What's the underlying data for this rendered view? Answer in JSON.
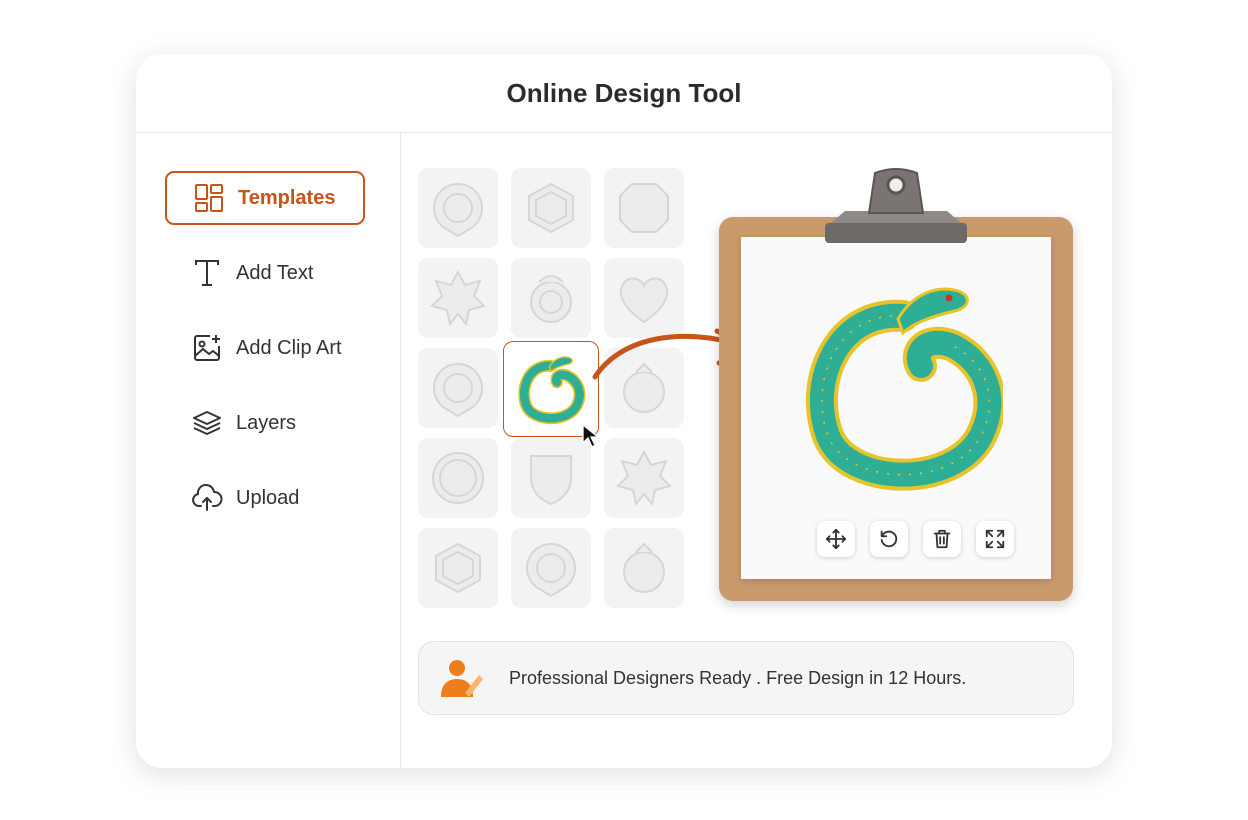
{
  "header": {
    "title": "Online Design Tool"
  },
  "sidebar": {
    "items": [
      {
        "label": "Templates",
        "icon": "grid-icon",
        "active": true
      },
      {
        "label": "Add Text",
        "icon": "text-icon"
      },
      {
        "label": "Add Clip Art",
        "icon": "image-add-icon"
      },
      {
        "label": "Layers",
        "icon": "layers-icon"
      },
      {
        "label": "Upload",
        "icon": "cloud-upload-icon"
      }
    ]
  },
  "templates": {
    "shapes": [
      "ring-emblem",
      "hexagon",
      "shield-octagon",
      "star-8",
      "crest",
      "heart",
      "ring-emblem",
      "snake-ouroboros",
      "rounded-crest",
      "circle",
      "shield",
      "star-8",
      "hexagon",
      "ring-emblem",
      "rounded-crest"
    ],
    "selected_index": 7
  },
  "canvas": {
    "toolbar": [
      {
        "icon": "move-icon"
      },
      {
        "icon": "rotate-icon"
      },
      {
        "icon": "trash-icon"
      },
      {
        "icon": "fullscreen-icon"
      }
    ]
  },
  "banner": {
    "text": "Professional Designers Ready . Free Design in 12 Hours.",
    "icon": "designer-icon"
  },
  "colors": {
    "accent": "#c9541a",
    "snake_teal": "#2fae96",
    "snake_gold": "#e8c42a",
    "board": "#c89a6c"
  }
}
